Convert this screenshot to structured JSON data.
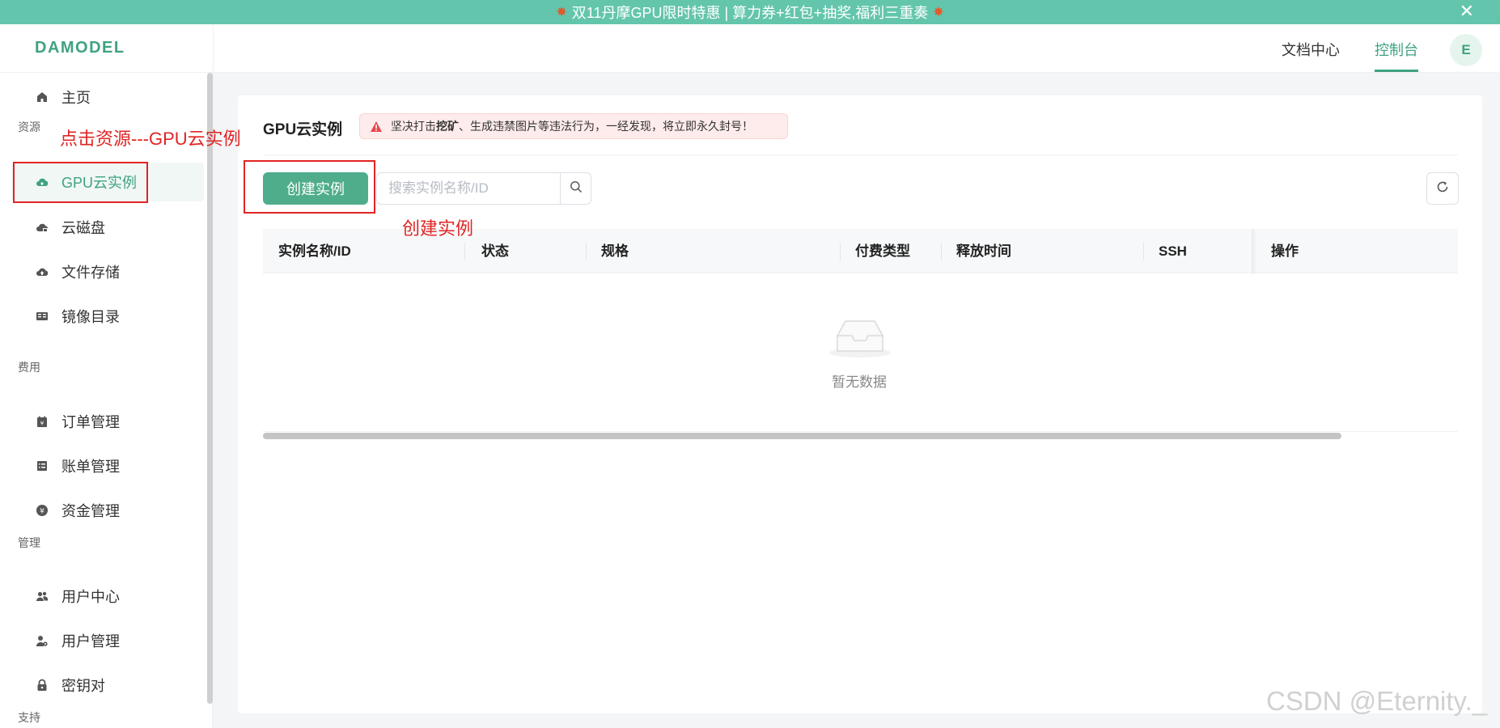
{
  "banner": {
    "text": "双11丹摩GPU限时特惠 | 算力券+红包+抽奖,福利三重奏",
    "close_glyph": "✕"
  },
  "header": {
    "logo": "DAMODEL",
    "nav": {
      "docs": "文档中心",
      "console": "控制台"
    },
    "avatar_letter": "E"
  },
  "sidebar": {
    "home": "主页",
    "sections": {
      "resources": "资源",
      "billing": "费用",
      "manage": "管理",
      "support": "支持"
    },
    "items": {
      "gpu": "GPU云实例",
      "disk": "云磁盘",
      "storage": "文件存储",
      "images": "镜像目录",
      "orders": "订单管理",
      "bills": "账单管理",
      "funds": "资金管理",
      "user_center": "用户中心",
      "user_manage": "用户管理",
      "keypair": "密钥对"
    }
  },
  "main": {
    "title": "GPU云实例",
    "warning": {
      "prefix": "坚决打击 ",
      "bold": "挖矿",
      "suffix": "、生成违禁图片等违法行为，一经发现，将立即永久封号！"
    },
    "create_button": "创建实例",
    "search_placeholder": "搜索实例名称/ID",
    "columns": [
      "实例名称/ID",
      "状态",
      "规格",
      "付费类型",
      "释放时间",
      "SSH",
      "操作"
    ],
    "empty_text": "暂无数据"
  },
  "annotations": {
    "sidebar_note": "点击资源---GPU云实例",
    "create_note": "创建实例"
  },
  "watermark": "CSDN @Eternity._",
  "colors": {
    "accent": "#3fa37f",
    "banner": "#63c5ac",
    "button": "#4fad8b",
    "annotation": "#e02424"
  }
}
